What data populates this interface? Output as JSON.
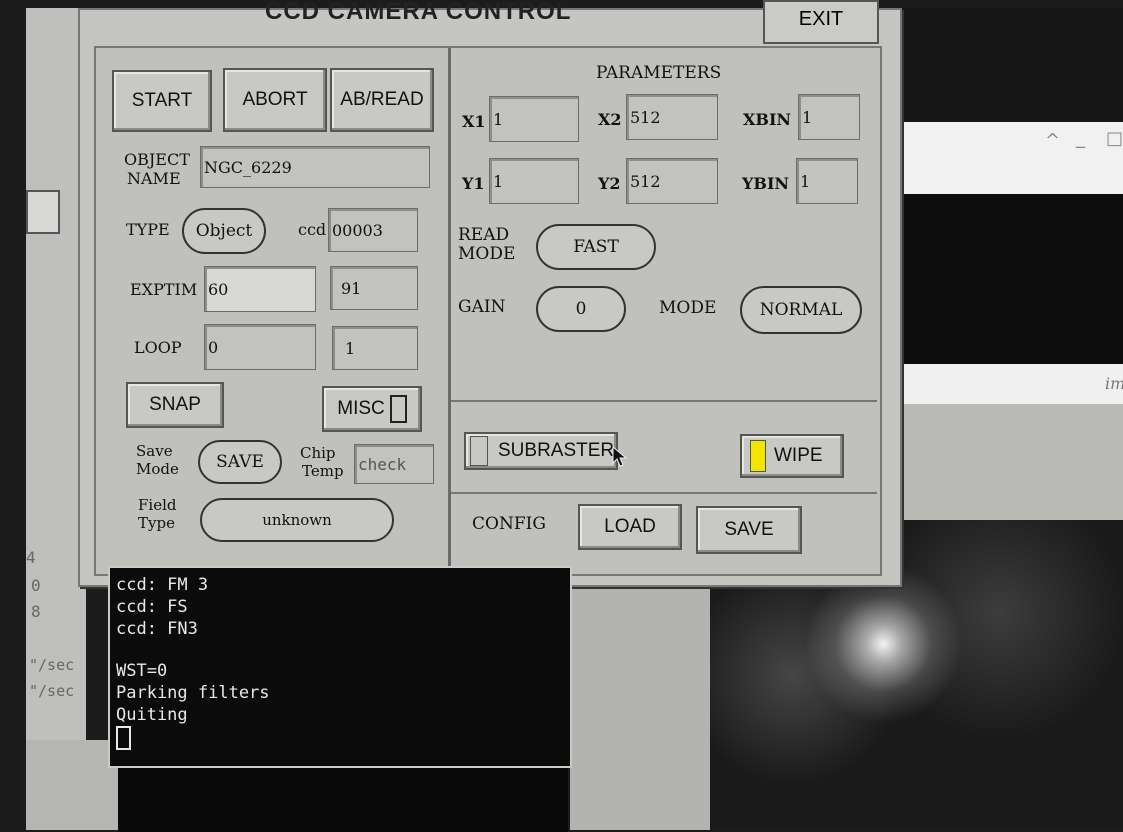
{
  "window": {
    "title": "CCD CAMERA CONTROL",
    "exit_label": "EXIT"
  },
  "controls": {
    "start_label": "START",
    "abort_label": "ABORT",
    "abread_label": "AB/READ",
    "object_name_label_1": "OBJECT",
    "object_name_label_2": "NAME",
    "object_name_value": "NGC_6229",
    "type_label": "TYPE",
    "type_value": "Object",
    "ccd_label": "ccd",
    "ccd_value": "00003",
    "exptim_label": "EXPTIM",
    "exptim_value": "60",
    "exptim_count": "91",
    "loop_label": "LOOP",
    "loop_value": "0",
    "loop_count": "1",
    "snap_label": "SNAP",
    "misc_label": "MISC",
    "save_mode_label_1": "Save",
    "save_mode_label_2": "Mode",
    "save_mode_value": "SAVE",
    "chip_temp_label_1": "Chip",
    "chip_temp_label_2": "Temp",
    "chip_temp_value": "check",
    "field_type_label_1": "Field",
    "field_type_label_2": "Type",
    "field_type_value": "unknown"
  },
  "parameters": {
    "heading": "PARAMETERS",
    "x1_label": "X1",
    "x1_value": "1",
    "x2_label": "X2",
    "x2_value": "512",
    "xbin_label": "XBIN",
    "xbin_value": "1",
    "y1_label": "Y1",
    "y1_value": "1",
    "y2_label": "Y2",
    "y2_value": "512",
    "ybin_label": "YBIN",
    "ybin_value": "1",
    "read_mode_label_1": "READ",
    "read_mode_label_2": "MODE",
    "read_mode_value": "FAST",
    "gain_label": "GAIN",
    "gain_value": "0",
    "mode_label": "MODE",
    "mode_value": "NORMAL",
    "subraster_label": "SUBRASTER",
    "wipe_label": "WIPE",
    "config_label": "CONFIG",
    "load_label": "LOAD",
    "save_label": "SAVE"
  },
  "console": {
    "lines": [
      "ccd: FM 3",
      "ccd: FS",
      "ccd: FN3",
      "",
      "WST=0",
      "Parking filters",
      "Quiting"
    ]
  },
  "background": {
    "left_numbers": [
      "4",
      "0",
      "8"
    ],
    "left_rates": [
      "\"/sec",
      "\"/sec"
    ],
    "right_partial_text": "im",
    "window_controls": [
      "^",
      "_",
      "□"
    ]
  },
  "colors": {
    "wipe_indicator": "#f2e600",
    "panel": "#c0c0bd",
    "console_bg": "#0b0b0b"
  }
}
